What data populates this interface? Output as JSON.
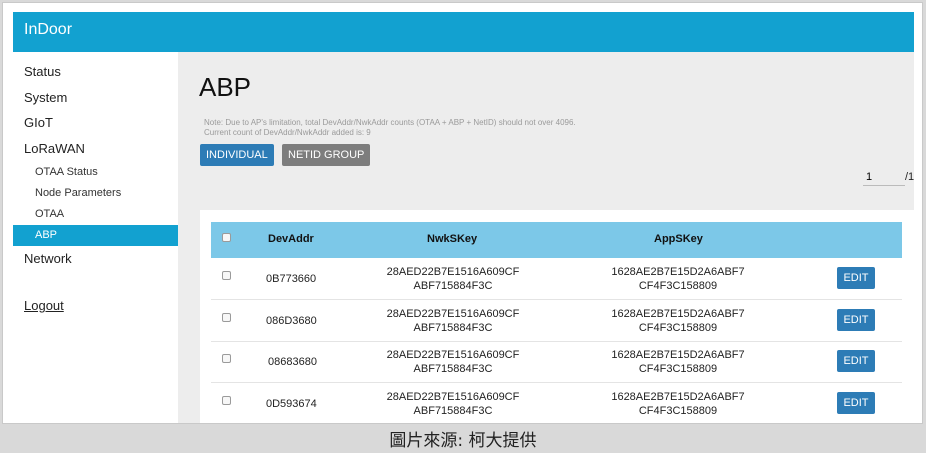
{
  "header": {
    "brand": "InDoor"
  },
  "sidebar": {
    "items": [
      {
        "label": "Status"
      },
      {
        "label": "System"
      },
      {
        "label": "GIoT"
      },
      {
        "label": "LoRaWAN"
      },
      {
        "label": "OTAA Status"
      },
      {
        "label": "Node Parameters"
      },
      {
        "label": "OTAA"
      },
      {
        "label": "ABP"
      },
      {
        "label": "Network"
      }
    ],
    "active": "ABP",
    "logout": "Logout"
  },
  "main": {
    "title": "ABP",
    "note_line1": "Note: Due to AP's limitation, total DevAddr/NwkAddr counts (OTAA + ABP + NetID) should not over 4096.",
    "note_line2": "Current count of DevAddr/NwkAddr added is: 9",
    "buttons": {
      "individual": "INDIVIDUAL",
      "netid_group": "NETID GROUP"
    },
    "pager": {
      "current": "1",
      "total": "/1"
    }
  },
  "table": {
    "columns": [
      "DevAddr",
      "NwkSKey",
      "AppSKey"
    ],
    "edit_label": "EDIT",
    "rows": [
      {
        "devaddr": "0B773660",
        "nwk1": "28AED22B7E1516A609CF",
        "nwk2": "ABF715884F3C",
        "app1": "1628AE2B7E15D2A6ABF7",
        "app2": "CF4F3C158809"
      },
      {
        "devaddr": "086D3680",
        "nwk1": "28AED22B7E1516A609CF",
        "nwk2": "ABF715884F3C",
        "app1": "1628AE2B7E15D2A6ABF7",
        "app2": "CF4F3C158809"
      },
      {
        "devaddr": "08683680",
        "nwk1": "28AED22B7E1516A609CF",
        "nwk2": "ABF715884F3C",
        "app1": "1628AE2B7E15D2A6ABF7",
        "app2": "CF4F3C158809"
      },
      {
        "devaddr": "0D593674",
        "nwk1": "28AED22B7E1516A609CF",
        "nwk2": "ABF715884F3C",
        "app1": "1628AE2B7E15D2A6ABF7",
        "app2": "CF4F3C158809"
      }
    ]
  },
  "caption": "圖片來源: 柯大提供"
}
